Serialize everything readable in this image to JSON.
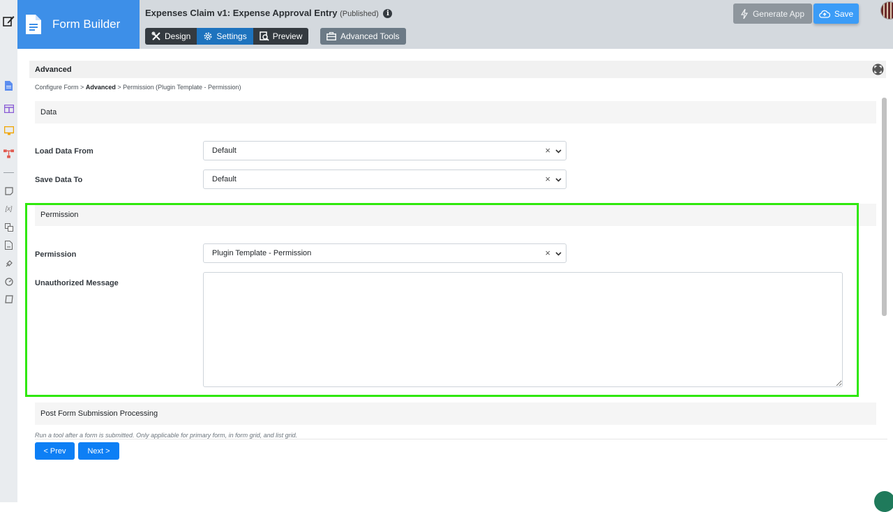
{
  "header": {
    "brand_title": "Form Builder",
    "form_title": "Expenses Claim v1: Expense Approval Entry",
    "form_status": "(Published)",
    "tabs": [
      {
        "label": "Design"
      },
      {
        "label": "Settings"
      },
      {
        "label": "Preview"
      }
    ],
    "advanced_tools": "Advanced Tools",
    "generate_app": "Generate App",
    "save": "Save"
  },
  "content": {
    "title": "Advanced",
    "breadcrumb": {
      "root": "Configure Form",
      "sep": ">",
      "current": "Advanced",
      "leaf": "Permission (Plugin Template - Permission)"
    }
  },
  "sections": {
    "data": {
      "title": "Data",
      "load_label": "Load Data From",
      "load_value": "Default",
      "save_label": "Save Data To",
      "save_value": "Default"
    },
    "permission": {
      "title": "Permission",
      "permission_label": "Permission",
      "permission_value": "Plugin Template - Permission",
      "message_label": "Unauthorized Message",
      "message_value": ""
    },
    "post": {
      "title": "Post Form Submission Processing",
      "note": "Run a tool after a form is submitted. Only applicable for primary form, in form grid, and list grid."
    }
  },
  "nav": {
    "prev": "< Prev",
    "next": "Next >"
  },
  "colors": {
    "brand": "#3d8fe8",
    "active_tab": "#1e73be",
    "save": "#3b9cf7",
    "nav_button": "#0d7ff5",
    "highlight": "#2fe80c"
  }
}
